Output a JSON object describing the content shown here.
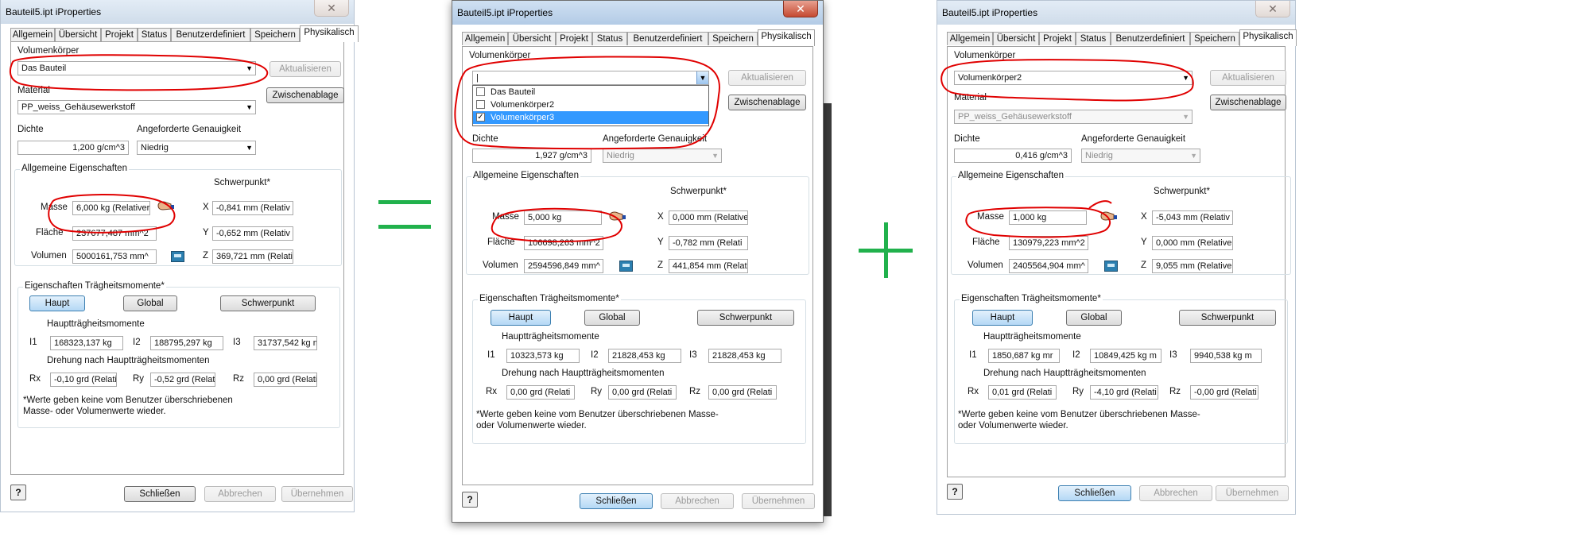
{
  "colors": {
    "accent_red": "#e00000",
    "operator_green": "#21b14c"
  },
  "windows": [
    {
      "title": "Bauteil5.ipt iProperties",
      "tabs": [
        "Allgemein",
        "Übersicht",
        "Projekt",
        "Status",
        "Benutzerdefiniert",
        "Speichern",
        "Physikalisch"
      ],
      "active_tab": "Physikalisch",
      "volumenkoerper_label": "Volumenkörper",
      "volumenkoerper_value": "Das Bauteil",
      "aktualisieren": "Aktualisieren",
      "zwischenablage": "Zwischenablage",
      "material_label": "Material",
      "material_value": "PP_weiss_Gehäusewerkstoff",
      "dichte_label": "Dichte",
      "dichte_value": "1,200 g/cm^3",
      "genauigkeit_label": "Angeforderte Genauigkeit",
      "genauigkeit_value": "Niedrig",
      "allg_label": "Allgemeine Eigenschaften",
      "schwerpunkt_label": "Schwerpunkt*",
      "masse_label": "Masse",
      "masse_value": "6,000 kg (Relativer",
      "flaeche_label": "Fläche",
      "flaeche_value": "237677,487 mm^2",
      "volumen_label": "Volumen",
      "volumen_value": "5000161,753 mm^",
      "x_label": "X",
      "x_value": "-0,841 mm (Relativ",
      "y_label": "Y",
      "y_value": "-0,652 mm (Relativ",
      "z_label": "Z",
      "z_value": "369,721 mm (Relati",
      "traeg_label": "Eigenschaften Trägheitsmomente*",
      "haupt": "Haupt",
      "global": "Global",
      "schwerpunkt_btn": "Schwerpunkt",
      "hauptt_label": "Hauptträgheitsmomente",
      "i1_label": "I1",
      "i1_value": "168323,137 kg",
      "i2_label": "I2",
      "i2_value": "188795,297 kg",
      "i3_label": "I3",
      "i3_value": "31737,542 kg m",
      "dreh_label": "Drehung nach Hauptträgheitsmomenten",
      "rx_label": "Rx",
      "rx_value": "-0,10 grd (Relati",
      "ry_label": "Ry",
      "ry_value": "-0,52 grd (Relati",
      "rz_label": "Rz",
      "rz_value": "0,00 grd (Relati",
      "note": "*Werte geben keine vom Benutzer überschriebenen Masse- oder Volumenwerte wieder.",
      "schliessen": "Schließen",
      "abbrechen": "Abbrechen",
      "uebernehmen": "Übernehmen",
      "help": "?"
    },
    {
      "title": "Bauteil5.ipt iProperties",
      "tabs": [
        "Allgemein",
        "Übersicht",
        "Projekt",
        "Status",
        "Benutzerdefiniert",
        "Speichern",
        "Physikalisch"
      ],
      "active_tab": "Physikalisch",
      "volumenkoerper_label": "Volumenkörper",
      "volumenkoerper_value": "|",
      "dropdown_items": [
        {
          "label": "Das Bauteil",
          "checked": false,
          "selected": false
        },
        {
          "label": "Volumenkörper2",
          "checked": false,
          "selected": false
        },
        {
          "label": "Volumenkörper3",
          "checked": true,
          "selected": true
        }
      ],
      "aktualisieren": "Aktualisieren",
      "zwischenablage": "Zwischenablage",
      "dichte_label": "Dichte",
      "dichte_value": "1,927 g/cm^3",
      "genauigkeit_label": "Angeforderte Genauigkeit",
      "genauigkeit_value": "Niedrig",
      "allg_label": "Allgemeine Eigenschaften",
      "schwerpunkt_label": "Schwerpunkt*",
      "masse_label": "Masse",
      "masse_value": "5,000 kg",
      "flaeche_label": "Fläche",
      "flaeche_value": "106698,263 mm^2",
      "volumen_label": "Volumen",
      "volumen_value": "2594596,849 mm^",
      "x_label": "X",
      "x_value": "0,000 mm (Relative",
      "y_label": "Y",
      "y_value": "-0,782 mm (Relati",
      "z_label": "Z",
      "z_value": "441,854 mm (Relati",
      "traeg_label": "Eigenschaften Trägheitsmomente*",
      "haupt": "Haupt",
      "global": "Global",
      "schwerpunkt_btn": "Schwerpunkt",
      "hauptt_label": "Hauptträgheitsmomente",
      "i1_label": "I1",
      "i1_value": "10323,573 kg",
      "i2_label": "I2",
      "i2_value": "21828,453 kg",
      "i3_label": "I3",
      "i3_value": "21828,453 kg",
      "dreh_label": "Drehung nach Hauptträgheitsmomenten",
      "rx_label": "Rx",
      "rx_value": "0,00 grd (Relati",
      "ry_label": "Ry",
      "ry_value": "0,00 grd (Relati",
      "rz_label": "Rz",
      "rz_value": "0,00 grd (Relati",
      "note": "*Werte geben keine vom Benutzer überschriebenen Masse- oder Volumenwerte wieder.",
      "schliessen": "Schließen",
      "abbrechen": "Abbrechen",
      "uebernehmen": "Übernehmen",
      "help": "?"
    },
    {
      "title": "Bauteil5.ipt iProperties",
      "tabs": [
        "Allgemein",
        "Übersicht",
        "Projekt",
        "Status",
        "Benutzerdefiniert",
        "Speichern",
        "Physikalisch"
      ],
      "active_tab": "Physikalisch",
      "volumenkoerper_label": "Volumenkörper",
      "volumenkoerper_value": "Volumenkörper2",
      "aktualisieren": "Aktualisieren",
      "zwischenablage": "Zwischenablage",
      "material_label": "Material",
      "material_value": "PP_weiss_Gehäusewerkstoff",
      "dichte_label": "Dichte",
      "dichte_value": "0,416 g/cm^3",
      "genauigkeit_label": "Angeforderte Genauigkeit",
      "genauigkeit_value": "Niedrig",
      "allg_label": "Allgemeine Eigenschaften",
      "schwerpunkt_label": "Schwerpunkt*",
      "masse_label": "Masse",
      "masse_value": "1,000 kg",
      "flaeche_label": "Fläche",
      "flaeche_value": "130979,223 mm^2",
      "volumen_label": "Volumen",
      "volumen_value": "2405564,904 mm^",
      "x_label": "X",
      "x_value": "-5,043 mm (Relativ",
      "y_label": "Y",
      "y_value": "0,000 mm (Relative",
      "z_label": "Z",
      "z_value": "9,055 mm (Relative",
      "traeg_label": "Eigenschaften Trägheitsmomente*",
      "haupt": "Haupt",
      "global": "Global",
      "schwerpunkt_btn": "Schwerpunkt",
      "hauptt_label": "Hauptträgheitsmomente",
      "i1_label": "I1",
      "i1_value": "1850,687 kg mr",
      "i2_label": "I2",
      "i2_value": "10849,425 kg m",
      "i3_label": "I3",
      "i3_value": "9940,538 kg m",
      "dreh_label": "Drehung nach Hauptträgheitsmomenten",
      "rx_label": "Rx",
      "rx_value": "0,01 grd (Relati",
      "ry_label": "Ry",
      "ry_value": "-4,10 grd (Relati",
      "rz_label": "Rz",
      "rz_value": "-0,00 grd (Relati",
      "note": "*Werte geben keine vom Benutzer überschriebenen Masse- oder Volumenwerte wieder.",
      "schliessen": "Schließen",
      "abbrechen": "Abbrechen",
      "uebernehmen": "Übernehmen",
      "help": "?"
    }
  ]
}
